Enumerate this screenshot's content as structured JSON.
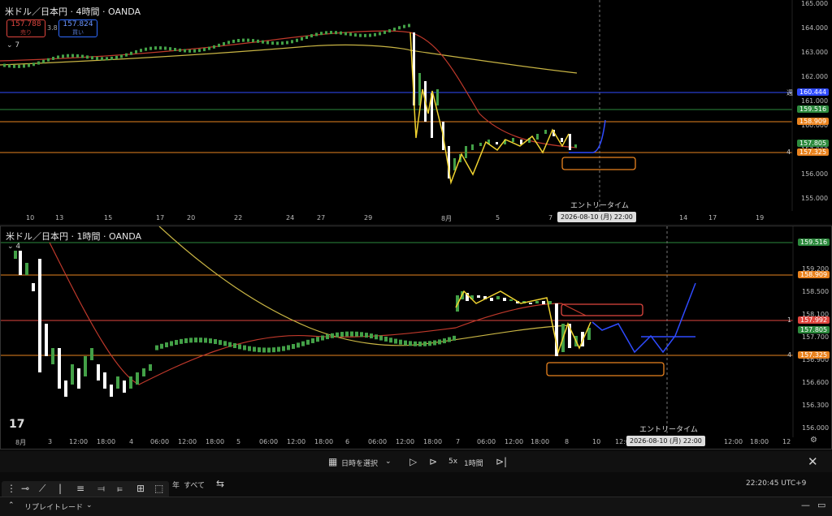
{
  "top_chart": {
    "symbol": "米ドル／日本円 · 4時間 · OANDA",
    "sell_price": "157.788",
    "sell_label": "売り",
    "spread": "3.8",
    "buy_price": "157.824",
    "buy_label": "買い",
    "indicator_count": "7",
    "price_ticks": [
      "165.000",
      "164.000",
      "163.000",
      "162.000",
      "161.000",
      "160.000",
      "157.000",
      "156.000",
      "155.000"
    ],
    "price_tags": [
      {
        "label": "160.444",
        "color": "#2f4bff",
        "side": "週"
      },
      {
        "label": "159.516",
        "color": "#2d8a3e"
      },
      {
        "label": "158.909",
        "color": "#e9831f"
      },
      {
        "label": "157.805",
        "color": "#2d8a3e"
      },
      {
        "label": "157.325",
        "color": "#e9831f",
        "side": "4"
      }
    ],
    "time_ticks": [
      "10",
      "13",
      "15",
      "17",
      "20",
      "22",
      "24",
      "27",
      "29",
      "8月",
      "5",
      "7",
      "14",
      "17",
      "19"
    ],
    "entry_label": "エントリータイム",
    "crosshair_time": "2026-08-10 (月)   22:00"
  },
  "bottom_chart": {
    "symbol": "米ドル／日本円 · 1時間 · OANDA",
    "indicator_count": "4",
    "price_ticks": [
      "159.200",
      "158.500",
      "158.100",
      "157.700",
      "156.900",
      "156.600",
      "156.300",
      "156.000"
    ],
    "price_tags": [
      {
        "label": "159.516",
        "color": "#2d8a3e"
      },
      {
        "label": "158.909",
        "color": "#e9831f"
      },
      {
        "label": "157.992",
        "color": "#e0463f",
        "side": "1"
      },
      {
        "label": "157.805",
        "color": "#2d8a3e"
      },
      {
        "label": "157.325",
        "color": "#e9831f",
        "side": "4"
      }
    ],
    "time_ticks": [
      "8月",
      "3",
      "12:00",
      "18:00",
      "4",
      "06:00",
      "12:00",
      "18:00",
      "5",
      "06:00",
      "12:00",
      "18:00",
      "6",
      "06:00",
      "12:00",
      "18:00",
      "7",
      "06:00",
      "12:00",
      "18:00",
      "8",
      "10",
      "12:00",
      "12:00",
      "18:00",
      "12"
    ],
    "entry_label": "エントリータイム",
    "crosshair_time": "2026-08-10 (月)   22:00"
  },
  "replay_toolbar": {
    "select_date": "日時を選択",
    "speed": "5x",
    "interval": "1時間"
  },
  "status_bar": {
    "period_year": "年",
    "period_all": "すべて",
    "clock": "22:20:45 UTC+9",
    "replay_trade": "リプレイトレード"
  }
}
